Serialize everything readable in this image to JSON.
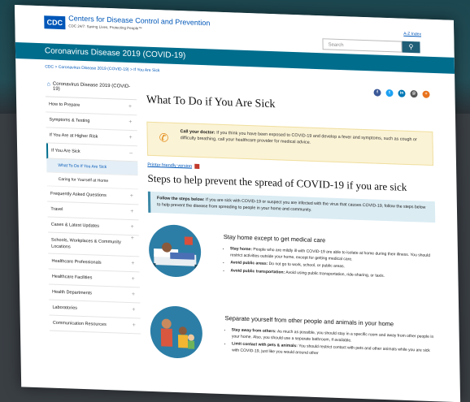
{
  "header": {
    "logo": "CDC",
    "org_name": "Centers for Disease Control and Prevention",
    "tagline": "CDC 24/7: Saving Lives, Protecting People™",
    "az_index": "A-Z Index",
    "search_placeholder": "Search",
    "search_icon": "magnifier"
  },
  "banner": {
    "title": "Coronavirus Disease 2019 (COVID-19)"
  },
  "breadcrumb": {
    "items": [
      "CDC",
      "Coronavirus Disease 2019 (COVID-19)",
      "If You Are Sick"
    ],
    "separator": ">"
  },
  "sidebar": {
    "home": "Coronavirus Disease 2019 (COVID-19)",
    "items": [
      {
        "label": "How to Prepare",
        "toggle": "+"
      },
      {
        "label": "Symptoms & Testing",
        "toggle": "+"
      },
      {
        "label": "If You Are at Higher Risk",
        "toggle": "+"
      },
      {
        "label": "If You Are Sick",
        "toggle": "–"
      },
      {
        "label": "What To Do If You Are Sick"
      },
      {
        "label": "Caring for Yourself at Home"
      },
      {
        "label": "Frequently Asked Questions",
        "toggle": "+"
      },
      {
        "label": "Travel",
        "toggle": "+"
      },
      {
        "label": "Cases & Latest Updates",
        "toggle": "+"
      },
      {
        "label": "Schools, Workplaces & Community Locations",
        "toggle": "+"
      },
      {
        "label": "Healthcare Professionals",
        "toggle": "+"
      },
      {
        "label": "Healthcare Facilities",
        "toggle": "+"
      },
      {
        "label": "Health Departments",
        "toggle": "+"
      },
      {
        "label": "Laboratories",
        "toggle": "+"
      },
      {
        "label": "Communication Resources",
        "toggle": "+"
      }
    ]
  },
  "social": [
    {
      "icon": "facebook-icon",
      "glyph": "f",
      "color": "#3b5998"
    },
    {
      "icon": "twitter-icon",
      "glyph": "t",
      "color": "#1da1f2"
    },
    {
      "icon": "linkedin-icon",
      "glyph": "in",
      "color": "#0077b5"
    },
    {
      "icon": "email-icon",
      "glyph": "@",
      "color": "#555555"
    },
    {
      "icon": "syndicate-icon",
      "glyph": "+",
      "color": "#e8731e"
    }
  ],
  "main": {
    "title": "What To Do if You Are Sick",
    "call_label": "Call your doctor:",
    "call_text": "If you think you have been exposed to COVID-19 and develop a fever and symptoms, such as cough or difficulty breathing, call your healthcare provider for medical advice.",
    "printer_friendly": "Printer friendly version",
    "steps_heading": "Steps to help prevent the spread of COVID-19 if you are sick",
    "follow_label": "Follow the steps below:",
    "follow_text": "If you are sick with COVID-19 or suspect you are infected with the virus that causes COVID-19, follow the steps below to help prevent the disease from spreading to people in your home and community.",
    "sections": [
      {
        "heading": "Stay home except to get medical care",
        "bullets": [
          {
            "label": "Stay home:",
            "text": "People who are mildly ill with COVID-19 are able to isolate at home during their illness. You should restrict activities outside your home, except for getting medical care."
          },
          {
            "label": "Avoid public areas:",
            "text": "Do not go to work, school, or public areas."
          },
          {
            "label": "Avoid public transportation:",
            "text": "Avoid using public transportation, ride-sharing, or taxis."
          }
        ]
      },
      {
        "heading": "Separate yourself from other people and animals in your home",
        "bullets": [
          {
            "label": "Stay away from others:",
            "text": "As much as possible, you should stay in a specific room and away from other people in your home. Also, you should use a separate bathroom, if available."
          },
          {
            "label": "Limit contact with pets & animals:",
            "text": "You should restrict contact with pets and other animals while you are sick with COVID-19, just like you would around other"
          }
        ]
      }
    ]
  }
}
